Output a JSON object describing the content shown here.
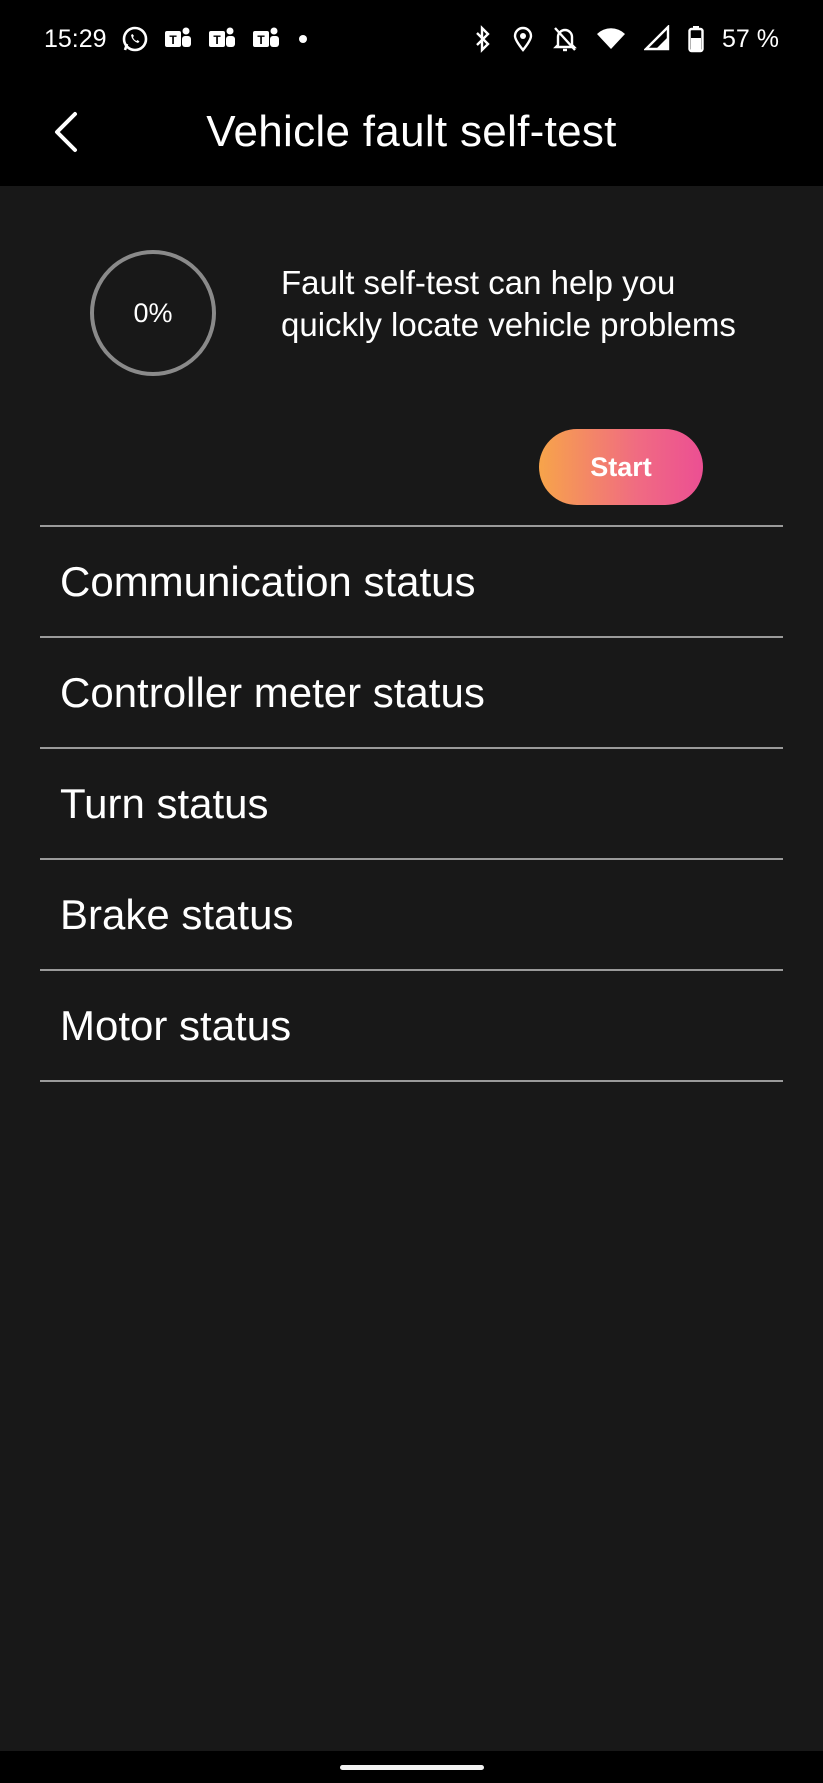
{
  "status_bar": {
    "time": "15:29",
    "notification_icons": [
      "whatsapp-icon",
      "teams-icon",
      "teams-icon",
      "teams-icon",
      "dot-icon"
    ],
    "system_icons": [
      "bluetooth-icon",
      "location-icon",
      "bell-off-icon",
      "wifi-icon",
      "signal-icon",
      "battery-icon"
    ],
    "battery": "57 %"
  },
  "app_bar": {
    "back_icon": "chevron-left-icon",
    "title": "Vehicle fault self-test"
  },
  "selftest": {
    "progress_label": "0%",
    "progress_value": 0,
    "description": "Fault self-test can help you quickly locate vehicle problems",
    "start_label": "Start",
    "start_gradient": [
      "#f7a44a",
      "#ec4f93"
    ]
  },
  "status_list": {
    "items": [
      {
        "label": "Communication status"
      },
      {
        "label": "Controller meter status"
      },
      {
        "label": "Turn status"
      },
      {
        "label": "Brake status"
      },
      {
        "label": "Motor status"
      }
    ]
  },
  "colors": {
    "background": "#181818",
    "bars": "#000000",
    "divider": "#9a9a9a"
  }
}
